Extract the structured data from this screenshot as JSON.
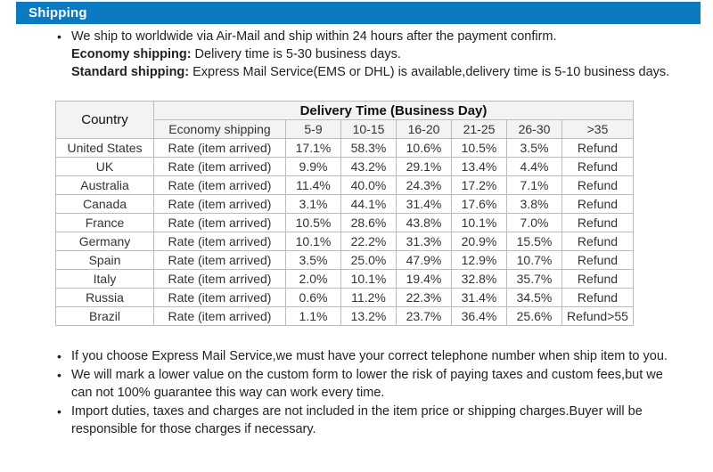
{
  "banner": {
    "title": "Shipping"
  },
  "intro": {
    "bullet": "We ship to worldwide via Air-Mail and ship within 24 hours after the payment confirm.",
    "economy_label": "Economy shipping:",
    "economy_text": " Delivery time is 5-30 business days.",
    "standard_label": "Standard shipping:",
    "standard_text": " Express Mail Service(EMS or DHL) is available,delivery time is 5-10 business days."
  },
  "table": {
    "country_header": "Country",
    "group_header": "Delivery Time (Business Day)",
    "sub_headers": [
      "Economy shipping",
      "5-9",
      "10-15",
      "16-20",
      "21-25",
      "26-30",
      ">35"
    ],
    "rate_label": "Rate (item arrived)",
    "rows": [
      {
        "country": "United States",
        "rate": "Rate (item arrived)",
        "values": [
          "17.1%",
          "58.3%",
          "10.6%",
          "10.5%",
          "3.5%"
        ],
        "last": "Refund"
      },
      {
        "country": "UK",
        "rate": "Rate (item arrived)",
        "values": [
          "9.9%",
          "43.2%",
          "29.1%",
          "13.4%",
          "4.4%"
        ],
        "last": "Refund"
      },
      {
        "country": "Australia",
        "rate": "Rate (item arrived)",
        "values": [
          "11.4%",
          "40.0%",
          "24.3%",
          "17.2%",
          "7.1%"
        ],
        "last": "Refund"
      },
      {
        "country": "Canada",
        "rate": "Rate (item arrived)",
        "values": [
          "3.1%",
          "44.1%",
          "31.4%",
          "17.6%",
          "3.8%"
        ],
        "last": "Refund"
      },
      {
        "country": "France",
        "rate": "Rate (item arrived)",
        "values": [
          "10.5%",
          "28.6%",
          "43.8%",
          "10.1%",
          "7.0%"
        ],
        "last": "Refund"
      },
      {
        "country": "Germany",
        "rate": "Rate (item arrived)",
        "values": [
          "10.1%",
          "22.2%",
          "31.3%",
          "20.9%",
          "15.5%"
        ],
        "last": "Refund"
      },
      {
        "country": "Spain",
        "rate": "Rate (item arrived)",
        "values": [
          "3.5%",
          "25.0%",
          "47.9%",
          "12.9%",
          "10.7%"
        ],
        "last": "Refund"
      },
      {
        "country": "Italy",
        "rate": "Rate (item arrived)",
        "values": [
          "2.0%",
          "10.1%",
          "19.4%",
          "32.8%",
          "35.7%"
        ],
        "last": "Refund"
      },
      {
        "country": "Russia",
        "rate": "Rate (item arrived)",
        "values": [
          "0.6%",
          "11.2%",
          "22.3%",
          "31.4%",
          "34.5%"
        ],
        "last": "Refund"
      },
      {
        "country": "Brazil",
        "rate": "Rate (item arrived)",
        "values": [
          "1.1%",
          "13.2%",
          "23.7%",
          "36.4%",
          "25.6%"
        ],
        "last": "Refund>55"
      }
    ]
  },
  "notes": [
    "If you choose Express Mail Service,we must have your correct telephone number when ship item to you.",
    "We will mark a lower value on the custom form to lower the risk of paying taxes and custom fees,but we can not 100% guarantee this way can work every time.",
    "Import duties, taxes and charges are not included in the item price or shipping charges.Buyer will be responsible for those charges if necessary."
  ],
  "colors": {
    "banner_background": "#0c7ac0",
    "banner_text": "#ffffff",
    "table_header_background": "#f3f3f3",
    "table_border": "#bcbcbc",
    "text": "#222222"
  }
}
